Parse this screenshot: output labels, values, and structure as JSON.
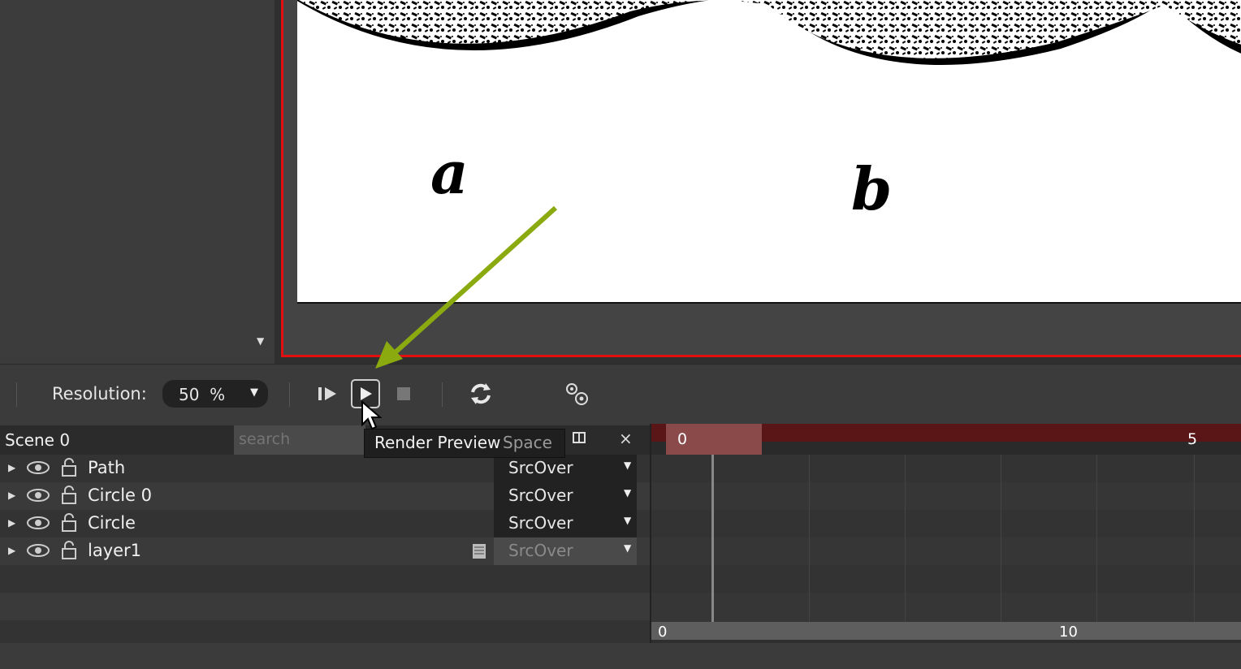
{
  "toolbar": {
    "resolution_label": "Resolution:",
    "resolution_value": "50",
    "resolution_unit": "%",
    "dropdown_glyph": "▼"
  },
  "tooltip": {
    "title": "Render Preview",
    "shortcut": "Space"
  },
  "layer_panel": {
    "scene_name": "Scene 0",
    "search_placeholder": "search",
    "close_glyph": "×",
    "layers": [
      {
        "name": "Path",
        "blend": "SrcOver",
        "enabled": true
      },
      {
        "name": "Circle 0",
        "blend": "SrcOver",
        "enabled": true
      },
      {
        "name": "Circle",
        "blend": "SrcOver",
        "enabled": true
      },
      {
        "name": "layer1",
        "blend": "SrcOver",
        "enabled": false
      }
    ]
  },
  "canvas": {
    "letters": [
      "a",
      "b"
    ]
  },
  "timeline": {
    "ruler_ticks": [
      "0",
      "5"
    ],
    "scroll_ticks": [
      "0",
      "10"
    ]
  },
  "colors": {
    "canvas_border": "#e01010",
    "annotation_arrow": "#8aaa10",
    "timeline_ruler": "#5a1616"
  },
  "icons": [
    "play-next-frame-icon",
    "play-icon",
    "stop-icon",
    "refresh-icon",
    "settings-gears-icon",
    "eye-icon",
    "lock-icon",
    "mask-icon",
    "columns-icon",
    "close-icon"
  ]
}
